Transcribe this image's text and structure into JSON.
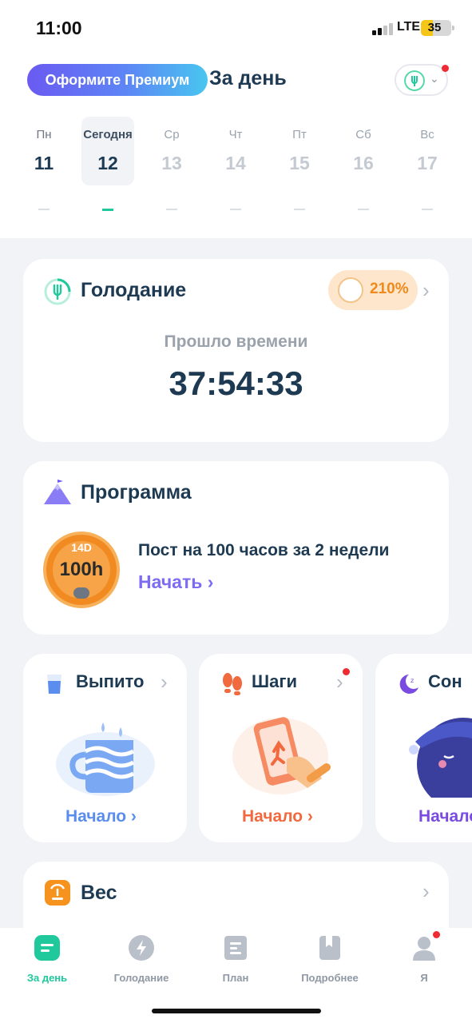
{
  "status": {
    "time": "11:00",
    "network": "LTE",
    "battery": "35"
  },
  "header": {
    "premium_label": "Оформите Премиум",
    "title": "За день"
  },
  "week": [
    {
      "name": "Пн",
      "date": "11"
    },
    {
      "name": "Сегодня",
      "date": "12"
    },
    {
      "name": "Ср",
      "date": "13"
    },
    {
      "name": "Чт",
      "date": "14"
    },
    {
      "name": "Пт",
      "date": "15"
    },
    {
      "name": "Сб",
      "date": "16"
    },
    {
      "name": "Вс",
      "date": "17"
    }
  ],
  "fasting": {
    "title": "Голодание",
    "progress": "210%",
    "elapsed_label": "Прошло времени",
    "elapsed": "37:54:33"
  },
  "program": {
    "title": "Программа",
    "badge_top": "14D",
    "badge_main": "100h",
    "name": "Пост на 100 часов за 2 недели",
    "start": "Начать ›"
  },
  "mini_cards": {
    "water": {
      "title": "Выпито",
      "start": "Начало ›"
    },
    "steps": {
      "title": "Шаги",
      "start": "Начало ›"
    },
    "sleep": {
      "title": "Сон",
      "start": "Начало"
    }
  },
  "weight": {
    "title": "Вес"
  },
  "colors": {
    "accent": "#1fc99b",
    "program": "#7b6cf2",
    "water": "#5b8def",
    "steps": "#f0693f",
    "sleep": "#7a4be0",
    "premium": "#6a5af2"
  },
  "tabs": [
    {
      "label": "За день"
    },
    {
      "label": "Голодание"
    },
    {
      "label": "План"
    },
    {
      "label": "Подробнее"
    },
    {
      "label": "Я"
    }
  ]
}
